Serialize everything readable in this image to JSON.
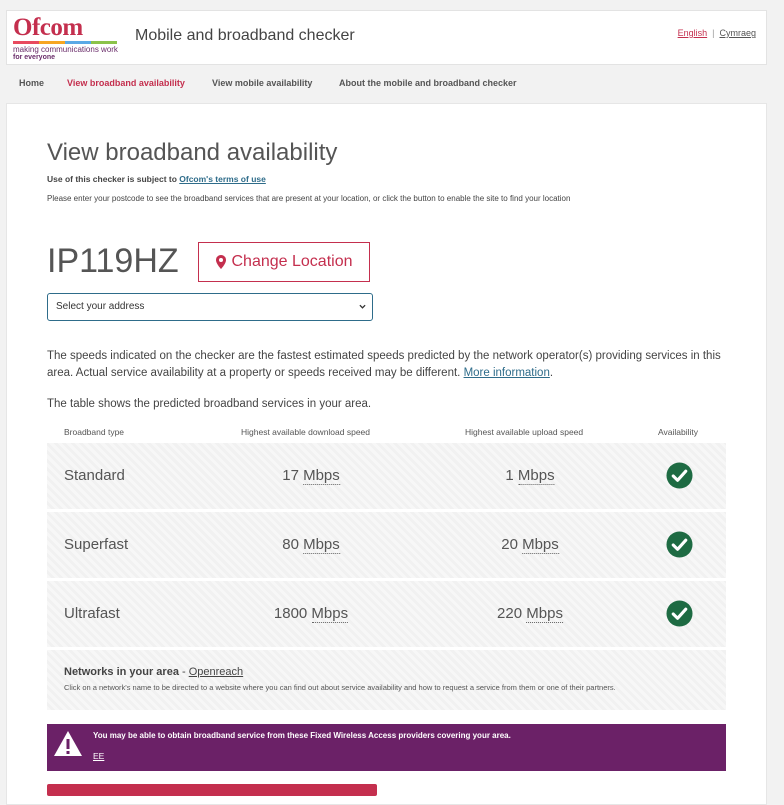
{
  "header": {
    "logo": {
      "word": "Ofcom",
      "tagline": "making communications work",
      "tagline2": "for everyone"
    },
    "app_title": "Mobile and broadband checker",
    "lang": {
      "english": "English",
      "separator": "|",
      "welsh": "Cymraeg",
      "active": "english"
    }
  },
  "nav": {
    "items": [
      {
        "label": "Home",
        "active": false
      },
      {
        "label": "View broadband availability",
        "active": true
      },
      {
        "label": "View mobile availability",
        "active": false
      },
      {
        "label": "About the mobile and broadband checker",
        "active": false
      }
    ]
  },
  "main": {
    "title": "View broadband availability",
    "terms_prefix": "Use of this checker is subject to ",
    "terms_link": "Ofcom's terms of use",
    "instructions": "Please enter your postcode to see the broadband services that are present at your location, or click the button to enable the site to find your location",
    "postcode": "IP119HZ",
    "change_location": {
      "icon": "map-marker-icon",
      "label": "Change Location"
    },
    "address_select": {
      "selected": "Select your address"
    },
    "speeds_note": "The speeds indicated on the checker are the fastest estimated speeds predicted by the network operator(s) providing services in this area. Actual service availability at a property or speeds received may be different. ",
    "more_info": "More information",
    "period": ".",
    "table_intro": "The table shows the predicted broadband services in your area."
  },
  "table": {
    "headers": {
      "type": "Broadband type",
      "download": "Highest available download speed",
      "upload": "Highest available upload speed",
      "availability": "Availability"
    },
    "rows": [
      {
        "type": "Standard",
        "download": "17",
        "upload": "1",
        "unit": "Mbps",
        "available": true
      },
      {
        "type": "Superfast",
        "download": "80",
        "upload": "20",
        "unit": "Mbps",
        "available": true
      },
      {
        "type": "Ultrafast",
        "download": "1800",
        "upload": "220",
        "unit": "Mbps",
        "available": true
      }
    ],
    "networks": {
      "label": "Networks in your area",
      "dash": " - ",
      "link": "Openreach",
      "hint": "Click on a network's name to be directed to a website where you can find out about service availability and how to request a service from them or one of their partners."
    }
  },
  "fwa": {
    "message": "You may be able to obtain broadband service from these Fixed Wireless Access providers covering your area.",
    "provider": "EE"
  },
  "colors": {
    "brand": "#c42f4e",
    "purple": "#6b2167",
    "check": "#1e6b43",
    "link": "#2e6c8a"
  }
}
